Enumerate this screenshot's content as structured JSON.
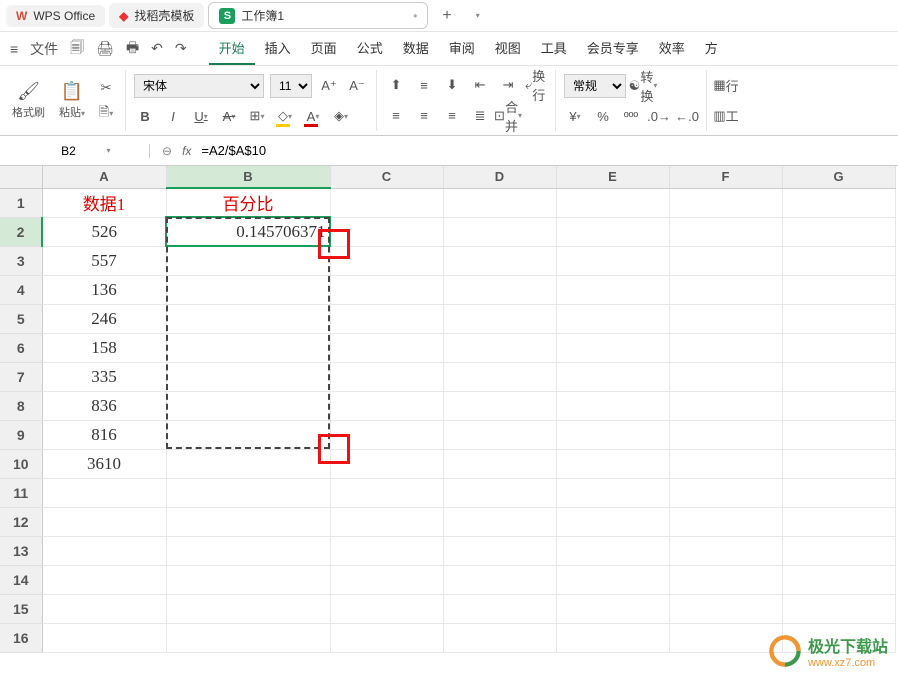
{
  "title_tabs": {
    "wps": "WPS Office",
    "template": "找稻壳模板",
    "workbook": "工作簿1"
  },
  "file_label": "文件",
  "menu": [
    "开始",
    "插入",
    "页面",
    "公式",
    "数据",
    "审阅",
    "视图",
    "工具",
    "会员专享",
    "效率",
    "方"
  ],
  "menu_active": 0,
  "ribbon": {
    "format_painter": "格式刷",
    "paste": "粘贴",
    "font_name": "宋体",
    "font_size": "11",
    "wrap": "换行",
    "merge": "合并",
    "number_format": "常规",
    "transpose": "转换",
    "row_col": "行",
    "sheet": "工"
  },
  "name_box": "B2",
  "formula": "=A2/$A$10",
  "columns": [
    "A",
    "B",
    "C",
    "D",
    "E",
    "F",
    "G"
  ],
  "rows": [
    "1",
    "2",
    "3",
    "4",
    "5",
    "6",
    "7",
    "8",
    "9",
    "10",
    "11",
    "12",
    "13",
    "14",
    "15",
    "16"
  ],
  "cells": {
    "A1": "数据1",
    "B1": "百分比",
    "A2": "526",
    "B2": "0.145706371",
    "A3": "557",
    "A4": "136",
    "A5": "246",
    "A6": "158",
    "A7": "335",
    "A8": "836",
    "A9": "816",
    "A10": "3610"
  },
  "chart_data": {
    "type": "table",
    "headers": [
      "数据1",
      "百分比"
    ],
    "rows": [
      [
        526,
        0.145706371
      ],
      [
        557,
        null
      ],
      [
        136,
        null
      ],
      [
        246,
        null
      ],
      [
        158,
        null
      ],
      [
        335,
        null
      ],
      [
        836,
        null
      ],
      [
        816,
        null
      ],
      [
        3610,
        null
      ]
    ],
    "note": "B2 = A2 / $A$10"
  },
  "watermark": {
    "title": "极光下载站",
    "url": "www.xz7.com"
  }
}
